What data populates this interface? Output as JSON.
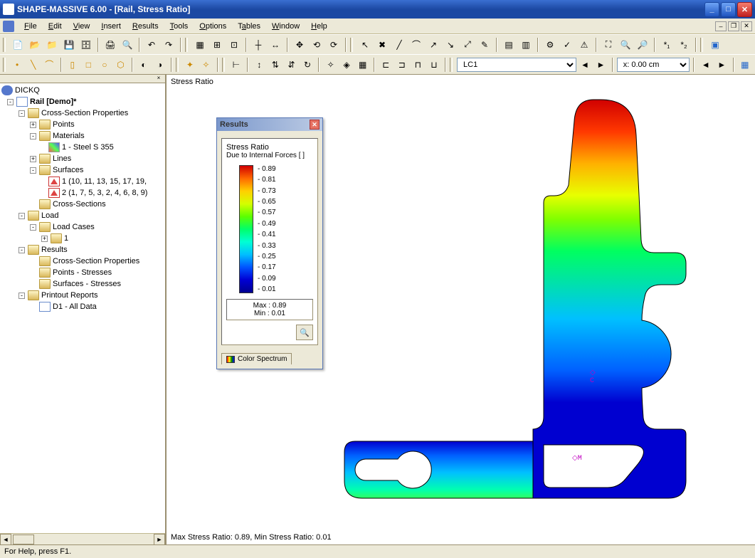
{
  "title": "SHAPE-MASSIVE 6.00 - [Rail, Stress Ratio]",
  "menu": [
    "File",
    "Edit",
    "View",
    "Insert",
    "Results",
    "Tools",
    "Options",
    "Tables",
    "Window",
    "Help"
  ],
  "toolbar_lc": "LC1",
  "toolbar_coord": "x: 0.00 cm",
  "tree": {
    "root": "DICKQ",
    "project": "Rail [Demo]*",
    "cs_props": "Cross-Section Properties",
    "points": "Points",
    "materials": "Materials",
    "material1": "1 - Steel S 355",
    "lines": "Lines",
    "surfaces": "Surfaces",
    "surf1": "1 (10, 11, 13, 15, 17, 19,",
    "surf2": "2 (1, 7, 5, 3, 2, 4, 6, 8, 9)",
    "cross_sections": "Cross-Sections",
    "load": "Load",
    "load_cases": "Load Cases",
    "lc1": "1",
    "results": "Results",
    "r_csprops": "Cross-Section Properties",
    "r_points": "Points - Stresses",
    "r_surfaces": "Surfaces - Stresses",
    "printout": "Printout Reports",
    "d1": "D1 - All Data"
  },
  "viewport": {
    "title": "Stress Ratio",
    "footer": "Max Stress Ratio: 0.89, Min Stress Ratio: 0.01"
  },
  "results_panel": {
    "title": "Results",
    "subtitle1": "Stress Ratio",
    "subtitle2": "Due to Internal Forces  [ ]",
    "scale": [
      "0.89",
      "0.81",
      "0.73",
      "0.65",
      "0.57",
      "0.49",
      "0.41",
      "0.33",
      "0.25",
      "0.17",
      "0.09",
      "0.01"
    ],
    "max": "Max  : 0.89",
    "min": "Min   : 0.01",
    "tab": "Color Spectrum"
  },
  "markers": {
    "c": "C",
    "m": "M"
  },
  "statusbar": "For Help, press F1."
}
